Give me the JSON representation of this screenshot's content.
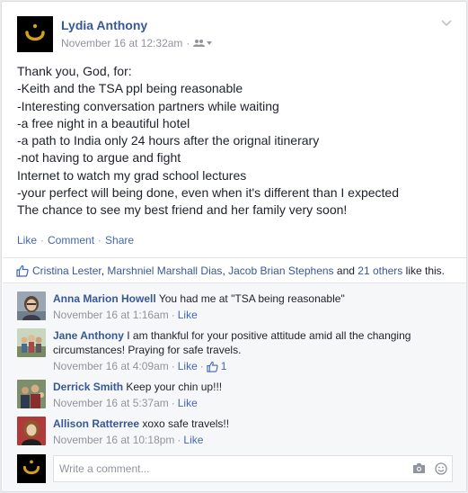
{
  "post": {
    "author": "Lydia Anthony",
    "timestamp": "November 16 at 12:32am",
    "separator": "·",
    "lines": [
      "Thank you, God, for:",
      "-Keith and the TSA ppl being reasonable",
      "-Interesting conversation partners while waiting",
      "-a free night in a beautiful hotel",
      "-a path to India only 24 hours after the orignal itinerary",
      "-not having to argue and fight",
      "Internet to watch my grad school lectures",
      "-your perfect will being done, even when it's different than I expected",
      "The chance to see my best friend and her family very soon!"
    ],
    "actions": {
      "like": "Like",
      "comment": "Comment",
      "share": "Share",
      "sep": "·"
    }
  },
  "likes": {
    "names": [
      "Cristina Lester",
      "Marshniel Marshall Dias",
      "Jacob Brian Stephens"
    ],
    "comma": ",",
    "and": "and",
    "others": "21 others",
    "suffix": "like this."
  },
  "comments": [
    {
      "name": "Anna Marion Howell",
      "text": "You had me at \"TSA being reasonable\"",
      "time": "November 16 at 1:16am",
      "like": "Like",
      "sep": "·",
      "likes_count": ""
    },
    {
      "name": "Jane Anthony",
      "text": "I am thankful for your positive attitude amid all the changing circumstances! Praying for safe travels.",
      "time": "November 16 at 4:09am",
      "like": "Like",
      "sep": "·",
      "likes_count": "1"
    },
    {
      "name": "Derrick Smith",
      "text": "Keep your chin up!!!",
      "time": "November 16 at 5:37am",
      "like": "Like",
      "sep": "·",
      "likes_count": ""
    },
    {
      "name": "Allison Ratterree",
      "text": "xoxo safe travels!!",
      "time": "November 16 at 10:18pm",
      "like": "Like",
      "sep": "·",
      "likes_count": ""
    }
  ],
  "composer": {
    "placeholder": "Write a comment..."
  },
  "colors": {
    "link": "#365899",
    "action_link": "#4267b2",
    "meta": "#90949c",
    "logo_glyph": "#d4a017"
  }
}
